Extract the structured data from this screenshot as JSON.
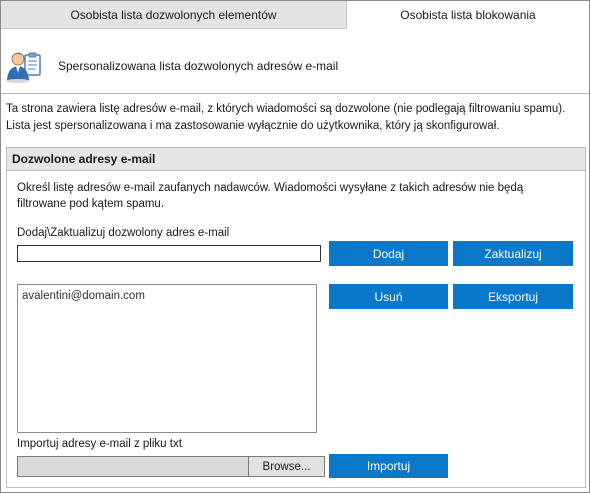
{
  "tabs": [
    {
      "label": "Osobista lista dozwolonych elementów"
    },
    {
      "label": "Osobista lista blokowania"
    }
  ],
  "header": {
    "title": "Spersonalizowana lista dozwolonych adresów e-mail",
    "icon": "user-clipboard-icon"
  },
  "description": "Ta strona zawiera listę adresów e-mail, z których wiadomości są dozwolone (nie podlegają filtrowaniu spamu). Lista jest spersonalizowana i ma zastosowanie wyłącznie do użytkownika, który ją skonfigurował.",
  "section": {
    "title": "Dozwolone adresy e-mail",
    "instructions": "Określ listę adresów e-mail zaufanych nadawców. Wiadomości wysyłane z takich adresów nie będą filtrowane pod kątem spamu.",
    "add_label": "Dodaj\\Zaktualizuj dozwolony adres e-mail",
    "add_input_value": "",
    "buttons": {
      "add": "Dodaj",
      "update": "Zaktualizuj",
      "remove": "Usuń",
      "export": "Eksportuj",
      "import": "Importuj",
      "browse": "Browse..."
    },
    "list_items": [
      "avalentini@domain.com"
    ],
    "import_label": "Importuj adresy e-mail z pliku txt"
  },
  "colors": {
    "button_blue": "#0a78c8",
    "tab_inactive_bg": "#e4e4e4",
    "section_header_bg": "#e6e6e6"
  }
}
